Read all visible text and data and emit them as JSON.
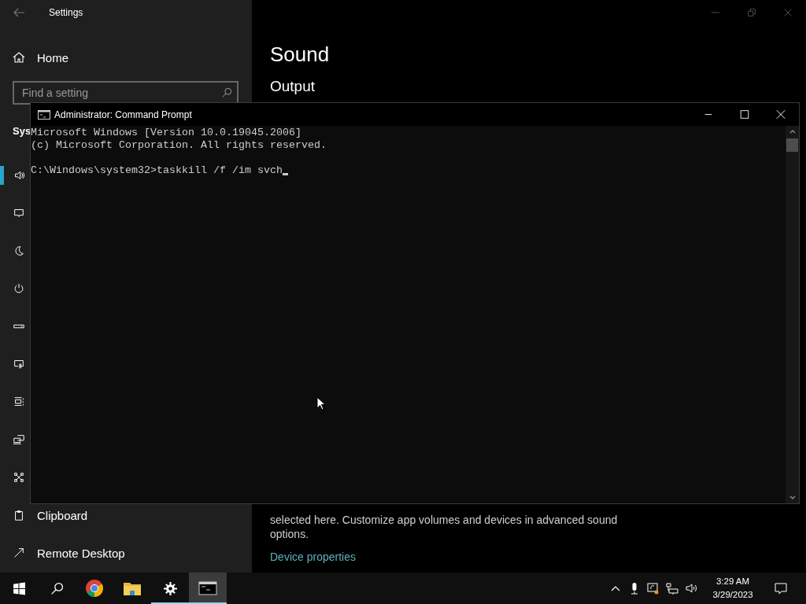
{
  "settings_window": {
    "title": "Settings",
    "sidebar": {
      "home": "Home",
      "search": {
        "placeholder": "Find a setting"
      },
      "section_heading": "Sys",
      "items": [
        {
          "selected": true
        },
        {
          "selected": false
        },
        {
          "selected": false
        },
        {
          "selected": false
        },
        {
          "selected": false
        },
        {
          "selected": false
        },
        {
          "selected": false
        },
        {
          "selected": false
        },
        {
          "selected": false
        },
        {
          "label": "Clipboard",
          "selected": false
        },
        {
          "label": "Remote Desktop",
          "selected": false
        }
      ]
    },
    "page": {
      "title": "Sound",
      "section": "Output",
      "description": "selected here. Customize app volumes and devices in advanced sound options.",
      "link": "Device properties"
    }
  },
  "cmd_window": {
    "title": "Administrator:  Command Prompt",
    "output": [
      "Microsoft Windows [Version 10.0.19045.2006]",
      "(c) Microsoft Corporation. All rights reserved."
    ],
    "prompt": "C:\\Windows\\system32>taskkill /f /im svch"
  },
  "taskbar": {
    "apps": [
      {
        "running": false,
        "selected": false
      },
      {
        "running": false,
        "selected": false
      },
      {
        "running": true,
        "selected": false
      },
      {
        "running": true,
        "selected": true
      }
    ],
    "clock": {
      "time": "3:29 AM",
      "date": "3/29/2023"
    }
  }
}
